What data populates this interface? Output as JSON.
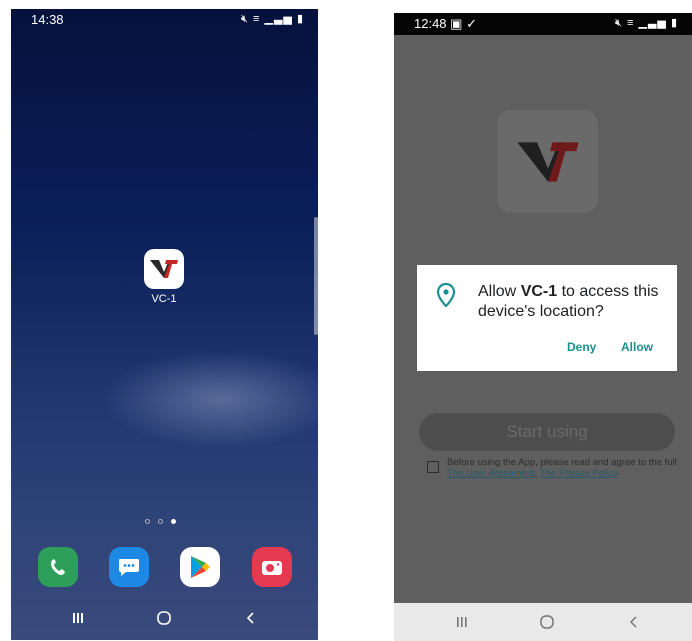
{
  "left_phone": {
    "status": {
      "time": "14:38"
    },
    "app": {
      "name": "VC-1"
    },
    "page_indicator": {
      "count": 3,
      "active": 3
    },
    "dock": [
      "phone-app",
      "messages-app",
      "play-store-app",
      "camera-app"
    ]
  },
  "right_phone": {
    "status": {
      "time": "12:48"
    },
    "dialog": {
      "text_prefix": "Allow ",
      "app_name": "VC-1",
      "text_suffix": " to access this device's location?",
      "deny": "Deny",
      "allow": "Allow"
    },
    "start_button": "Start using",
    "agreement": {
      "text": "Before using the App, please read and agree to the full ",
      "link1": "The User Agreement",
      "sep": ", ",
      "link2": "The Privacy Policy"
    }
  },
  "colors": {
    "accent": "#19908e",
    "logo_red": "#c62828",
    "logo_dark": "#2a2a2a"
  }
}
